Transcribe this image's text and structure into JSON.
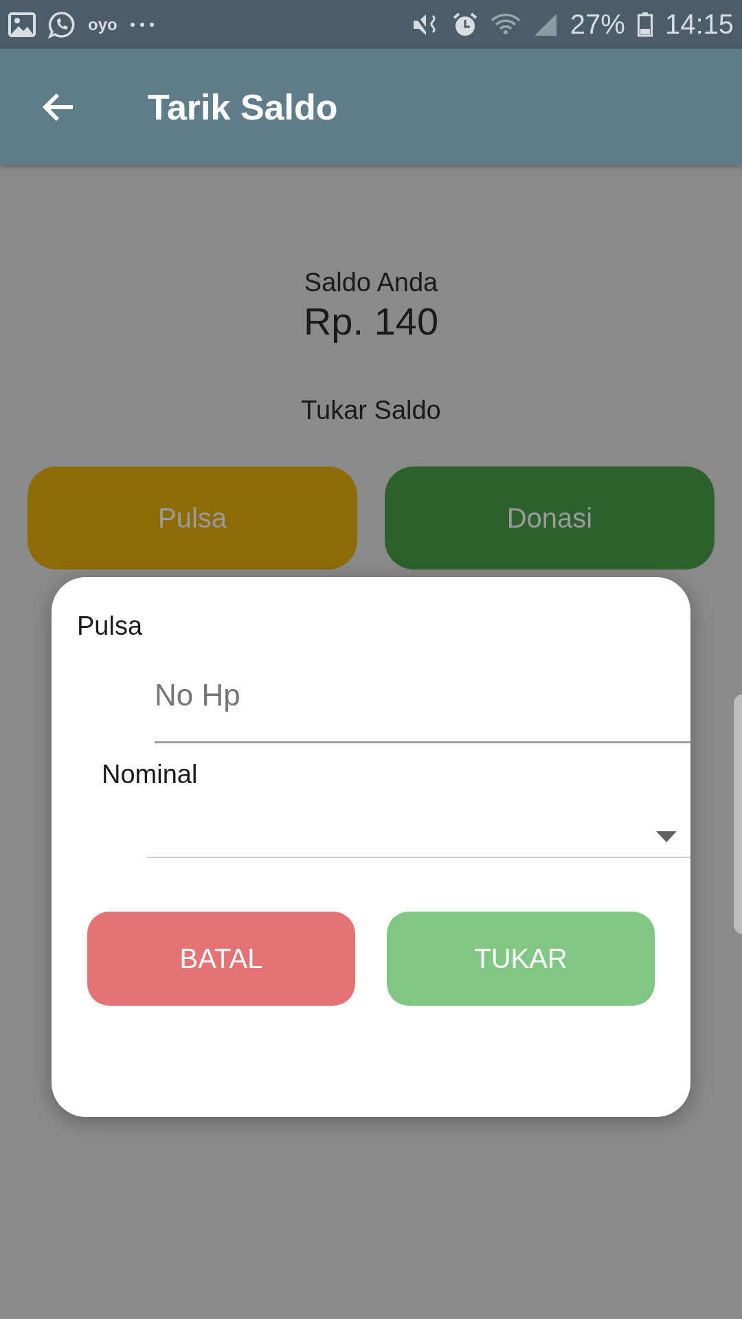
{
  "status_bar": {
    "notification_text": "oyo",
    "battery": "27%",
    "time": "14:15"
  },
  "app_bar": {
    "title": "Tarik Saldo"
  },
  "balance": {
    "label": "Saldo Anda",
    "amount": "Rp. 140"
  },
  "exchange": {
    "label": "Tukar Saldo",
    "options": [
      {
        "label": "Pulsa",
        "color": "#8c6c05"
      },
      {
        "label": "Donasi",
        "color": "#2c612e"
      }
    ]
  },
  "dialog": {
    "title": "Pulsa",
    "phone_field": {
      "placeholder": "No Hp"
    },
    "nominal": {
      "label": "Nominal"
    },
    "buttons": [
      {
        "label": "BATAL",
        "kind": "cancel"
      },
      {
        "label": "TUKAR",
        "kind": "confirm"
      }
    ]
  }
}
